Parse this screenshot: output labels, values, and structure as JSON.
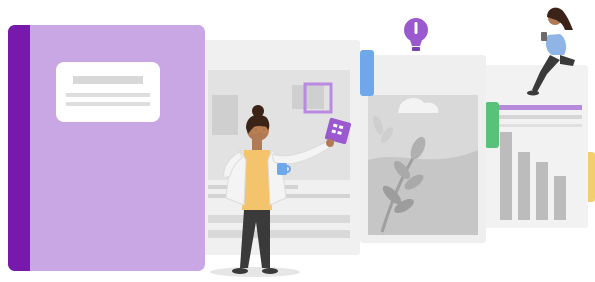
{
  "illustration": {
    "subject": "notebook-pages-illustration",
    "colors": {
      "notebook_cover": "#c9a6e4",
      "notebook_spine": "#7719aa",
      "label_box": "#ffffff",
      "page_fill": "#efefef",
      "page_inner": "#d9d9d9",
      "tab_blue": "#6ea8ea",
      "tab_green": "#59c27a",
      "tab_yellow": "#f2cf6c",
      "accent_purple": "#9b59d0",
      "figure_coat": "#f4f4f4",
      "figure_pants": "#3a3a3a",
      "figure_shirt": "#f3c46b",
      "figure_skin": "#b07a55",
      "figure_hair": "#3b2417",
      "sitting_shirt": "#8fb5e6"
    },
    "icons": [
      "lightbulb-icon",
      "tablet-icon",
      "mug-icon"
    ]
  }
}
